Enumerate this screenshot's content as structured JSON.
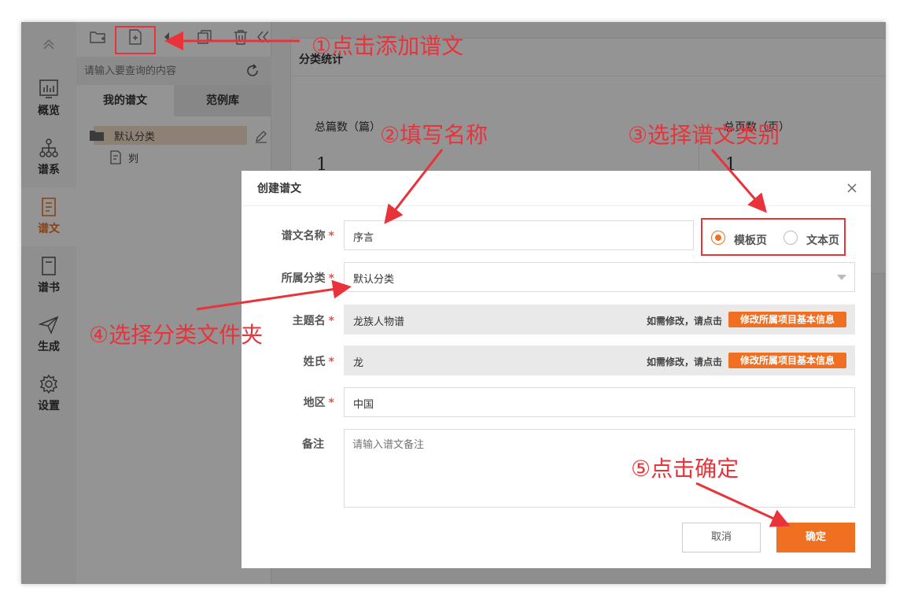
{
  "nav": {
    "items": [
      {
        "label": "概览",
        "icon": "bar-chart-icon"
      },
      {
        "label": "谱系",
        "icon": "tree-diagram-icon"
      },
      {
        "label": "谱文",
        "icon": "document-icon"
      },
      {
        "label": "谱书",
        "icon": "book-icon"
      },
      {
        "label": "生成",
        "icon": "paper-plane-icon"
      },
      {
        "label": "设置",
        "icon": "gear-icon"
      }
    ],
    "active": "谱文",
    "accent": "#f07022"
  },
  "panel": {
    "search_placeholder": "请输入要查询的内容",
    "tabs": [
      "我的谱文",
      "范例库"
    ],
    "folder": "默认分类",
    "file": "刿"
  },
  "content": {
    "section_title": "分类统计",
    "stats": [
      {
        "label": "总篇数（篇）",
        "value": "1"
      },
      {
        "label": "总页数（页）",
        "value": "1"
      }
    ]
  },
  "dialog": {
    "title": "创建谱文",
    "fields": {
      "name_label": "谱文名称",
      "name_value": "序言",
      "category_label": "所属分类",
      "category_value": "默认分类",
      "theme_label": "主题名",
      "theme_value": "龙族人物谱",
      "surname_label": "姓氏",
      "surname_value": "龙",
      "region_label": "地区",
      "region_value": "中国",
      "note_label": "备注",
      "note_placeholder": "请输入谱文备注"
    },
    "required_mark": "*",
    "modify_hint": "如需修改，请点击",
    "modify_button": "修改所属项目基本信息",
    "page_type": {
      "options": [
        "模板页",
        "文本页"
      ],
      "selected": "模板页"
    },
    "cancel_label": "取消",
    "confirm_label": "确定"
  },
  "annotations": {
    "step1": "①点击添加谱文",
    "step2": "②填写名称",
    "step3": "③选择谱文类别",
    "step4": "④选择分类文件夹",
    "step5": "⑤点击确定",
    "color": "#e8333b"
  }
}
